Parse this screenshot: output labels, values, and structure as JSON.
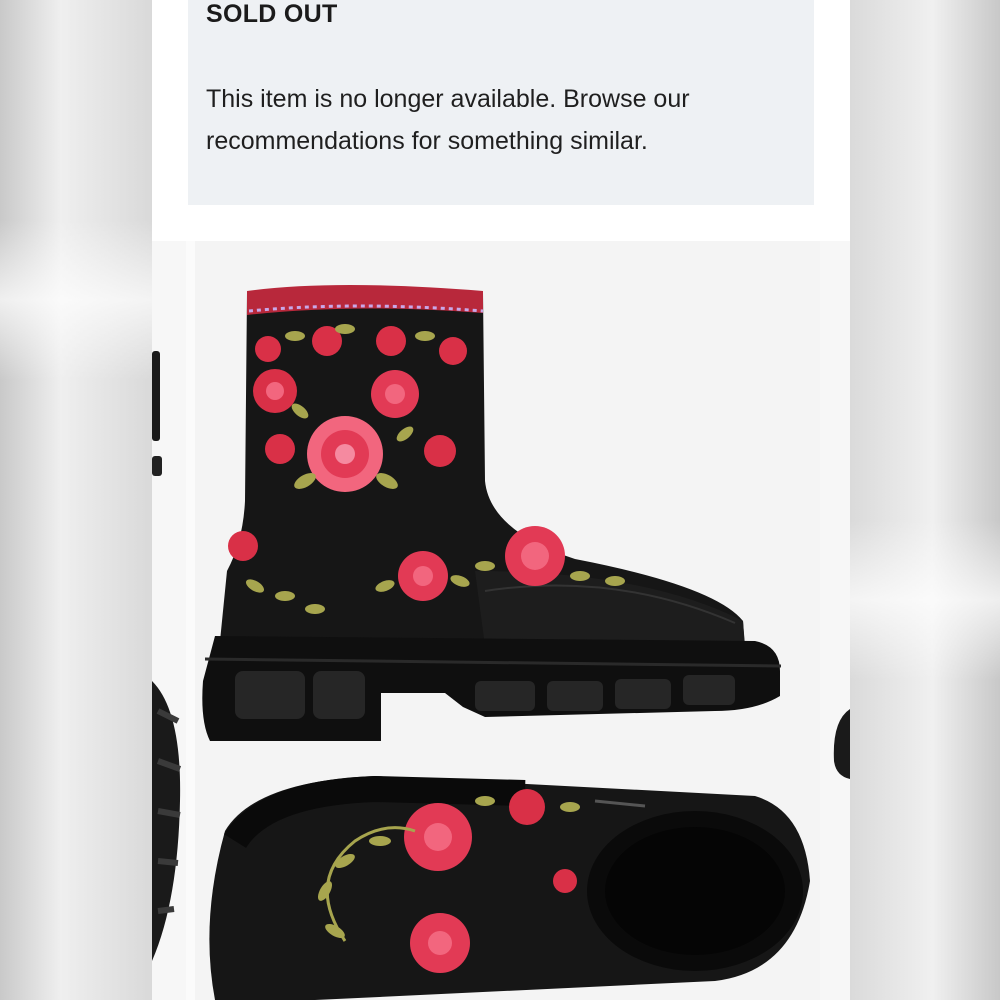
{
  "notice": {
    "title": "SOLD OUT",
    "message_line1": "This item is no longer available. Browse our",
    "message_line2": "recommendations for something similar."
  },
  "gallery": {
    "main_image_alt": "Black floral embroidered platform ankle boots",
    "colors": {
      "boot": "#141414",
      "rose": "#e23a55",
      "pink": "#f2667e",
      "leaf": "#a7a54e",
      "notice_bg": "#eef1f4"
    }
  }
}
